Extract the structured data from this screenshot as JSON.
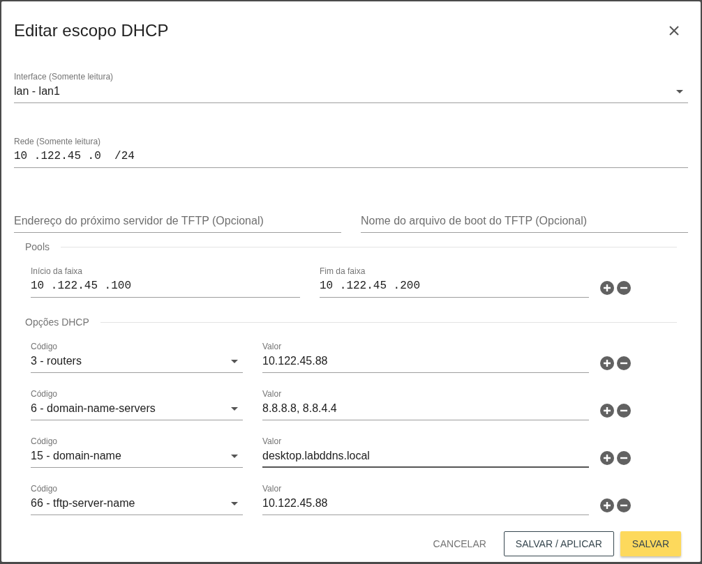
{
  "dialog": {
    "title": "Editar escopo DHCP"
  },
  "interface": {
    "label": "Interface (Somente leitura)",
    "value": "lan - lan1"
  },
  "network": {
    "label": "Rede (Somente leitura)",
    "value": "10 .122.45 .0  /24"
  },
  "tftp_fields": [
    {
      "placeholder": "Endereço do próximo servidor de TFTP (Opcional)"
    },
    {
      "placeholder": "Nome do arquivo de boot do TFTP (Opcional)"
    }
  ],
  "pools": {
    "title": "Pools",
    "rows": [
      {
        "start_label": "Início da faixa",
        "start": "10 .122.45 .100",
        "end_label": "Fim da faixa",
        "end": "10 .122.45 .200"
      }
    ]
  },
  "dhcp_options": {
    "title": "Opções DHCP",
    "rows": [
      {
        "code_label": "Código",
        "code": "3 - routers",
        "value_label": "Valor",
        "value": "10.122.45.88",
        "focused": false
      },
      {
        "code_label": "Código",
        "code": "6 - domain-name-servers",
        "value_label": "Valor",
        "value": "8.8.8.8, 8.8.4.4",
        "focused": false
      },
      {
        "code_label": "Código",
        "code": "15 - domain-name",
        "value_label": "Valor",
        "value": "desktop.labddns.local",
        "focused": true
      },
      {
        "code_label": "Código",
        "code": "66 - tftp-server-name",
        "value_label": "Valor",
        "value": "10.122.45.88",
        "focused": false
      }
    ]
  },
  "buttons": [
    {
      "label": "CANCELAR",
      "kind": "text"
    },
    {
      "label": "SALVAR / APLICAR",
      "kind": "outlined"
    },
    {
      "label": "SALVAR",
      "kind": "raised"
    }
  ]
}
